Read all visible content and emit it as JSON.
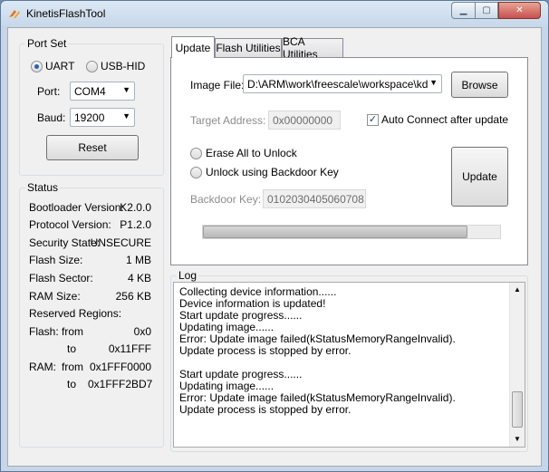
{
  "window": {
    "title": "KinetisFlashTool",
    "min_label": "▁",
    "max_label": "▢",
    "close_label": "✕"
  },
  "port_set": {
    "group_label": "Port Set",
    "uart_label": "UART",
    "usbhid_label": "USB-HID",
    "port_label": "Port:",
    "port_value": "COM4",
    "baud_label": "Baud:",
    "baud_value": "19200",
    "reset_label": "Reset"
  },
  "status": {
    "group_label": "Status",
    "rows": [
      {
        "label": "Bootloader Version:",
        "value": "K2.0.0"
      },
      {
        "label": "Protocol Version:",
        "value": "P1.2.0"
      },
      {
        "label": "Security State:",
        "value": "UNSECURE"
      },
      {
        "label": "Flash Size:",
        "value": "1 MB"
      },
      {
        "label": "Flash Sector:",
        "value": "4 KB"
      },
      {
        "label": "RAM Size:",
        "value": "256 KB"
      }
    ],
    "reserved_label": "Reserved Regions:",
    "flash_label": "Flash:",
    "flash_from_label": "from",
    "flash_from_value": "0x0",
    "flash_to_label": "to",
    "flash_to_value": "0x11FFF",
    "ram_label": "RAM:",
    "ram_from_label": "from",
    "ram_from_value": "0x1FFF0000",
    "ram_to_label": "to",
    "ram_to_value": "0x1FFF2BD7"
  },
  "tabs": [
    {
      "label": "Update"
    },
    {
      "label": "Flash Utilities"
    },
    {
      "label": "BCA Utilities"
    }
  ],
  "update": {
    "image_file_label": "Image File:",
    "image_file_value": "D:\\ARM\\work\\freescale\\workspace\\kds\\",
    "browse_label": "Browse",
    "target_address_label": "Target Address:",
    "target_address_value": "0x00000000",
    "auto_connect_label": "Auto Connect after update",
    "erase_all_label": "Erase All to Unlock",
    "backdoor_unlock_label": "Unlock using Backdoor Key",
    "backdoor_key_label": "Backdoor Key:",
    "backdoor_key_value": "0102030405060708",
    "update_button_label": "Update",
    "progress_fraction": 0.89
  },
  "log": {
    "group_label": "Log",
    "lines": [
      "Collecting device information......",
      "Device information is updated!",
      "Start update progress......",
      "Updating image......",
      "Error: Update image failed(kStatusMemoryRangeInvalid).",
      "Update process is stopped by error.",
      "",
      "Start update progress......",
      "Updating image......",
      "Error: Update image failed(kStatusMemoryRangeInvalid).",
      "Update process is stopped by error."
    ]
  },
  "colors": {
    "accent": "#2a60b0",
    "frame": "#c6d6e8",
    "close_button": "#c75050"
  }
}
